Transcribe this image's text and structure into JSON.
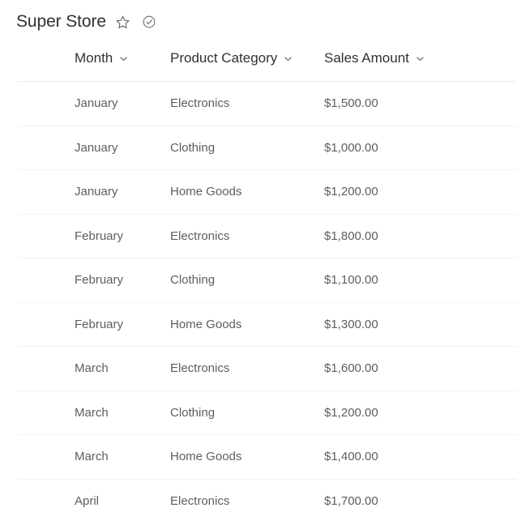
{
  "header": {
    "title": "Super Store",
    "icons": [
      {
        "name": "star-icon",
        "label": "Add to favorites"
      },
      {
        "name": "check-circle-icon",
        "label": "Published"
      }
    ]
  },
  "table": {
    "columns": [
      {
        "key": "month",
        "label": "Month",
        "sort_icon": "chevron-down-icon"
      },
      {
        "key": "category",
        "label": "Product Category",
        "sort_icon": "chevron-down-icon"
      },
      {
        "key": "sales",
        "label": "Sales Amount",
        "sort_icon": "chevron-down-icon"
      }
    ],
    "rows": [
      {
        "month": "January",
        "category": "Electronics",
        "sales": "$1,500.00"
      },
      {
        "month": "January",
        "category": "Clothing",
        "sales": "$1,000.00"
      },
      {
        "month": "January",
        "category": "Home Goods",
        "sales": "$1,200.00"
      },
      {
        "month": "February",
        "category": "Electronics",
        "sales": "$1,800.00"
      },
      {
        "month": "February",
        "category": "Clothing",
        "sales": "$1,100.00"
      },
      {
        "month": "February",
        "category": "Home Goods",
        "sales": "$1,300.00"
      },
      {
        "month": "March",
        "category": "Electronics",
        "sales": "$1,600.00"
      },
      {
        "month": "March",
        "category": "Clothing",
        "sales": "$1,200.00"
      },
      {
        "month": "March",
        "category": "Home Goods",
        "sales": "$1,400.00"
      },
      {
        "month": "April",
        "category": "Electronics",
        "sales": "$1,700.00"
      }
    ]
  },
  "colors": {
    "title_text": "#323130",
    "header_text": "#323130",
    "cell_text": "#605e5c",
    "icon": "#605e5c",
    "row_divider": "#f3f2f1",
    "header_divider": "#edebe9",
    "background": "#ffffff"
  }
}
